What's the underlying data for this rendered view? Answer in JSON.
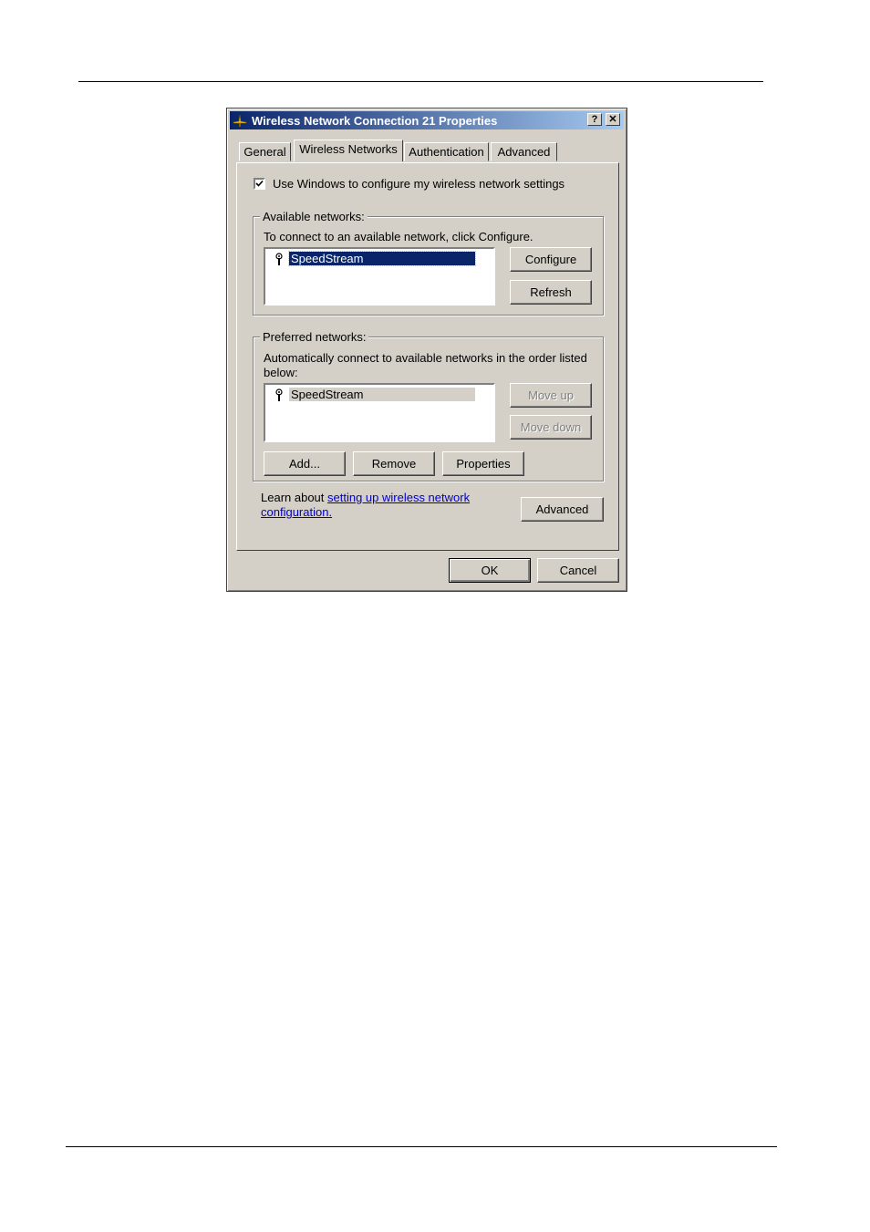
{
  "window": {
    "title": "Wireless Network Connection 21 Properties",
    "help_label": "?",
    "close_label": "✕"
  },
  "tabs": [
    {
      "label": "General",
      "active": false
    },
    {
      "label": "Wireless Networks",
      "active": true
    },
    {
      "label": "Authentication",
      "active": false
    },
    {
      "label": "Advanced",
      "active": false
    }
  ],
  "use_windows": {
    "label": "Use Windows to configure my wireless network settings",
    "checked": true
  },
  "available": {
    "legend": "Available networks:",
    "hint": "To connect to an available network, click Configure.",
    "items": [
      "SpeedStream"
    ],
    "configure_label": "Configure",
    "refresh_label": "Refresh"
  },
  "preferred": {
    "legend": "Preferred networks:",
    "hint_line1": "Automatically connect to available networks in the order listed",
    "hint_line2": "below:",
    "items": [
      "SpeedStream"
    ],
    "move_up_label": "Move up",
    "move_down_label": "Move down",
    "add_label": "Add...",
    "remove_label": "Remove",
    "properties_label": "Properties"
  },
  "learn": {
    "prefix": "Learn about",
    "link_line1": "setting up wireless network",
    "link_line2": "configuration."
  },
  "advanced_label": "Advanced",
  "ok_label": "OK",
  "cancel_label": "Cancel",
  "colors": {
    "selection": "#0a246a",
    "face": "#d4d0c8",
    "link": "#0000cc"
  },
  "icons": {
    "title_icon": "network-connection-icon",
    "network_icon": "wireless-antenna-icon"
  }
}
